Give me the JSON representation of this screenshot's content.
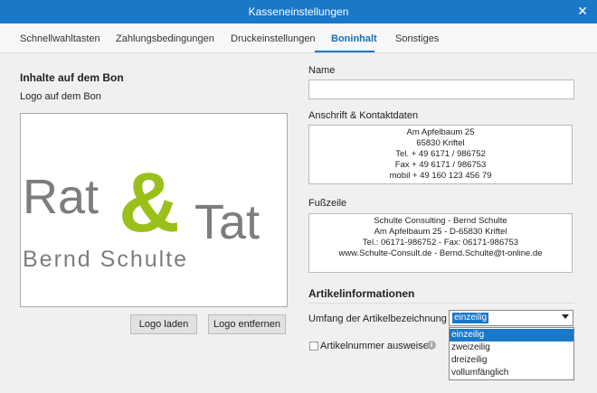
{
  "window": {
    "title": "Kasseneinstellungen",
    "close_glyph": "✕"
  },
  "tabs": [
    {
      "label": "Schnellwahltasten"
    },
    {
      "label": "Zahlungsbedingungen"
    },
    {
      "label": "Druckeinstellungen"
    },
    {
      "label": "Boninhalt"
    },
    {
      "label": "Sonstiges"
    }
  ],
  "active_tab": "Boninhalt",
  "left": {
    "title": "Inhalte auf dem Bon",
    "logo_label": "Logo auf dem Bon",
    "logo": {
      "word1": "Rat",
      "amp": "&",
      "word2": "Tat",
      "subtitle": "Bernd Schulte"
    },
    "load_button": "Logo laden",
    "remove_button": "Logo entfernen"
  },
  "right": {
    "name_label": "Name",
    "name_value": "",
    "address_label": "Anschrift & Kontaktdaten",
    "address_lines": [
      "Am Apfelbaum 25",
      "65830 Kriftel",
      "Tel. + 49 6171 / 986752",
      "Fax + 49 6171 / 986753",
      "mobil + 49 160 123 456 79"
    ],
    "footer_label": "Fußzeile",
    "footer_lines": [
      "Schulte Consulting - Bernd Schulte",
      "Am Apfelbaum 25 - D-65830 Kriftel",
      "Tel.: 06171-986752 - Fax: 06171-986753",
      "www.Schulte-Consult.de - Bernd.Schulte@t-online.de"
    ],
    "article_section": "Artikelinformationen",
    "article_desc_label": "Umfang der Artikelbezeichnung",
    "article_desc_selected": "einzeilig",
    "article_desc_options": [
      "einzeilig",
      "zweizeilig",
      "dreizeilig",
      "vollumfänglich"
    ],
    "article_number_label": "Artikelnummer ausweisen",
    "article_number_checked": false
  },
  "colors": {
    "accent": "#1a78c8",
    "logo_gray": "#7d7d7d",
    "logo_green": "#9bc01c"
  },
  "icons": {
    "info": "i"
  }
}
